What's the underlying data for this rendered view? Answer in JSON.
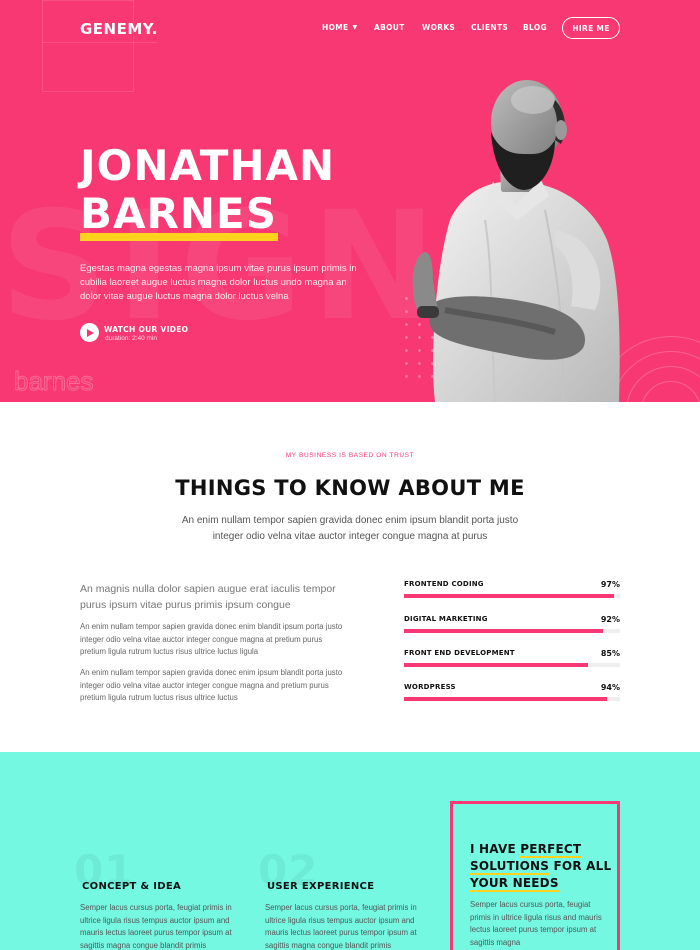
{
  "header": {
    "logo": "GENEMY.",
    "nav": [
      "HOME",
      "ABOUT",
      "WORKS",
      "CLIENTS",
      "BLOG"
    ],
    "cta": "HIRE ME"
  },
  "hero": {
    "name_line1": "JONATHAN",
    "name_line2": "BARNES",
    "description": "Egestas magna egestas magna ipsum vitae purus ipsum primis in cubilia laoreet augue luctus magna dolor luctus undo magna an dolor vitae augue luctus magna dolor luctus velna",
    "video_label": "WATCH OUR VIDEO",
    "video_duration": "duration: 2:40 min",
    "bg_word": "SIGN",
    "bg_small": "barnes"
  },
  "about": {
    "eyebrow": "MY BUSINESS IS BASED ON TRUST",
    "title": "THINGS TO KNOW ABOUT ME",
    "subtitle": "An enim nullam tempor sapien gravida donec enim ipsum blandit porta justo integer odio velna vitae auctor integer congue magna at purus",
    "lead": "An magnis nulla dolor sapien augue erat iaculis tempor purus ipsum vitae purus primis ipsum congue",
    "paragraphs": [
      "An enim nullam tempor sapien gravida donec enim blandit ipsum porta justo integer odio velna vitae auctor integer congue magna at pretium purus pretium ligula rutrum luctus risus ultrice luctus ligula",
      "An enim nullam tempor sapien gravida donec enim ipsum blandit porta justo integer odio velna vitae auctor integer congue magna and pretium purus pretium ligula rutrum luctus risus ultrice luctus"
    ],
    "skills": [
      {
        "name": "FRONTEND CODING",
        "percent": "97%",
        "value": 97
      },
      {
        "name": "DIGITAL MARKETING",
        "percent": "92%",
        "value": 92
      },
      {
        "name": "FRONT END DEVELOPMENT",
        "percent": "85%",
        "value": 85
      },
      {
        "name": "WORDPRESS",
        "percent": "94%",
        "value": 94
      }
    ]
  },
  "services": {
    "items": [
      {
        "num": "01",
        "title": "CONCEPT & IDEA",
        "text": "Semper lacus cursus porta, feugiat primis in ultrice ligula risus tempus auctor ipsum and mauris lectus laoreet purus tempor ipsum at sagittis magna congue blandit primis"
      },
      {
        "num": "02",
        "title": "USER EXPERIENCE",
        "text": "Semper lacus cursus porta, feugiat primis in ultrice ligula risus tempus auctor ipsum and mauris lectus laoreet purus tempor ipsum at sagittis magna congue blandit primis"
      }
    ],
    "box_title_a": "I HAVE ",
    "box_title_b": "PERFECT SOLUTIONS",
    "box_title_c": " FOR ALL ",
    "box_title_d": "YOUR NEEDS",
    "box_text": "Semper lacus cursus porta, feugiat primis in ultrice ligula risus and mauris lectus laoreet purus tempor ipsum at sagittis magna"
  },
  "colors": {
    "accent": "#f73873",
    "highlight": "#ffd21f",
    "services_bg": "#74f8e2"
  },
  "icons": [
    "play-icon",
    "chevron-down-icon"
  ]
}
